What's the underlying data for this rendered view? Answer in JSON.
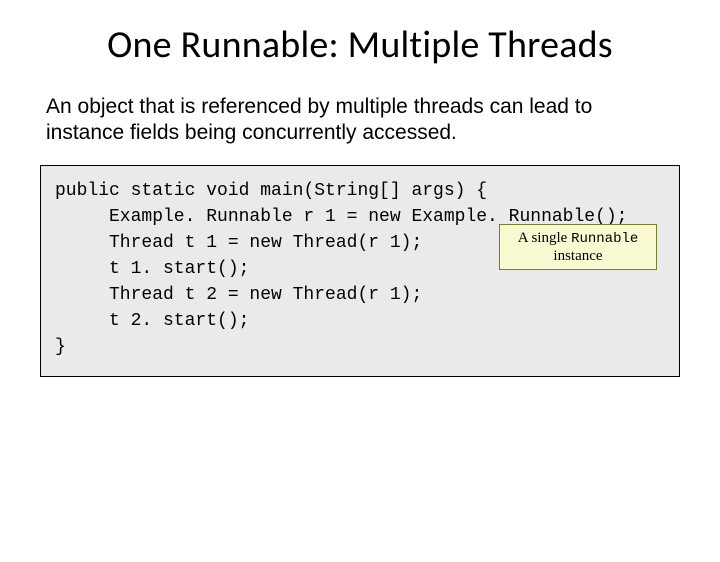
{
  "title": "One Runnable: Multiple Threads",
  "body": "An object that is referenced by multiple threads can lead to instance fields being concurrently accessed.",
  "code": {
    "l1": "public static void main(String[] args) {",
    "l2": "Example. Runnable r 1 = new Example. Runnable();",
    "l3": "Thread t 1 = new Thread(r 1);",
    "l4": "t 1. start();",
    "l5": "Thread t 2 = new Thread(r 1);",
    "l6": "t 2. start();",
    "l7": "}"
  },
  "callout": {
    "pre": "A single ",
    "mono": "Runnable",
    "post": " instance"
  }
}
